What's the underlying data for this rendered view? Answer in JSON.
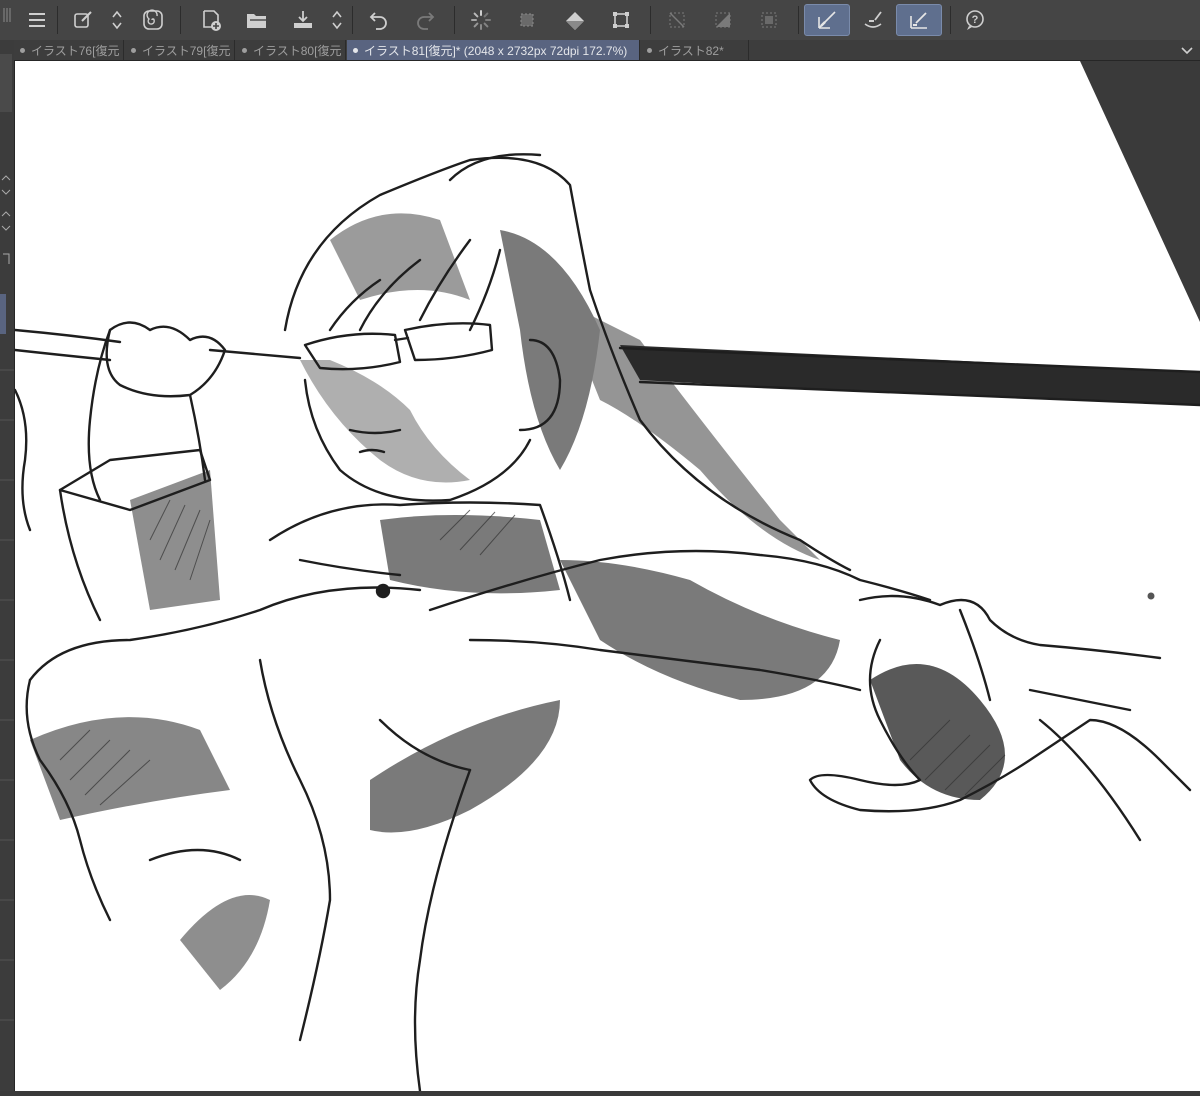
{
  "commandbar": {
    "buttons": [
      {
        "name": "menu-icon",
        "active": false
      },
      {
        "name": "edit-pen-icon",
        "active": false
      },
      {
        "name": "swap-updown-icon",
        "active": false
      },
      {
        "name": "spiral-logo-icon",
        "active": false
      },
      {
        "name": "new-canvas-icon",
        "active": false
      },
      {
        "name": "open-folder-icon",
        "active": false
      },
      {
        "name": "save-icon",
        "active": false
      },
      {
        "name": "updown-icon",
        "active": false
      },
      {
        "name": "undo-icon",
        "active": false
      },
      {
        "name": "redo-icon",
        "active": false
      },
      {
        "name": "loading-spinner-icon",
        "active": false
      },
      {
        "name": "clear-selection-icon",
        "active": false
      },
      {
        "name": "fill-icon",
        "active": false
      },
      {
        "name": "transform-icon",
        "active": false
      },
      {
        "name": "deselect-icon",
        "active": false
      },
      {
        "name": "invert-selection-icon",
        "active": false
      },
      {
        "name": "show-selection-icon",
        "active": false
      },
      {
        "name": "snap-to-ruler-icon",
        "active": true
      },
      {
        "name": "snap-to-special-ruler-icon",
        "active": false
      },
      {
        "name": "snap-to-grid-icon",
        "active": true
      },
      {
        "name": "help-icon",
        "active": false
      }
    ]
  },
  "tabs": [
    {
      "label": "イラスト76[復元",
      "active": false
    },
    {
      "label": "イラスト79[復元",
      "active": false
    },
    {
      "label": "イラスト80[復元",
      "active": false
    },
    {
      "label": "イラスト81[復元]* (2048 x 2732px 72dpi 172.7%)",
      "active": true
    },
    {
      "label": "イラスト82*",
      "active": false
    }
  ],
  "colors": {
    "ui_dark": "#454545",
    "tab_active": "#596480",
    "active_button": "#5f6f8e",
    "canvas_paper": "#ffffff",
    "sketch_line": "#1e1e1e",
    "sketch_tone": "#7a7a7a"
  },
  "artwork": {
    "subject": "grayscale manga-style sketch: long-haired figure with glasses holding a long staff behind the head, arm outstretched"
  }
}
